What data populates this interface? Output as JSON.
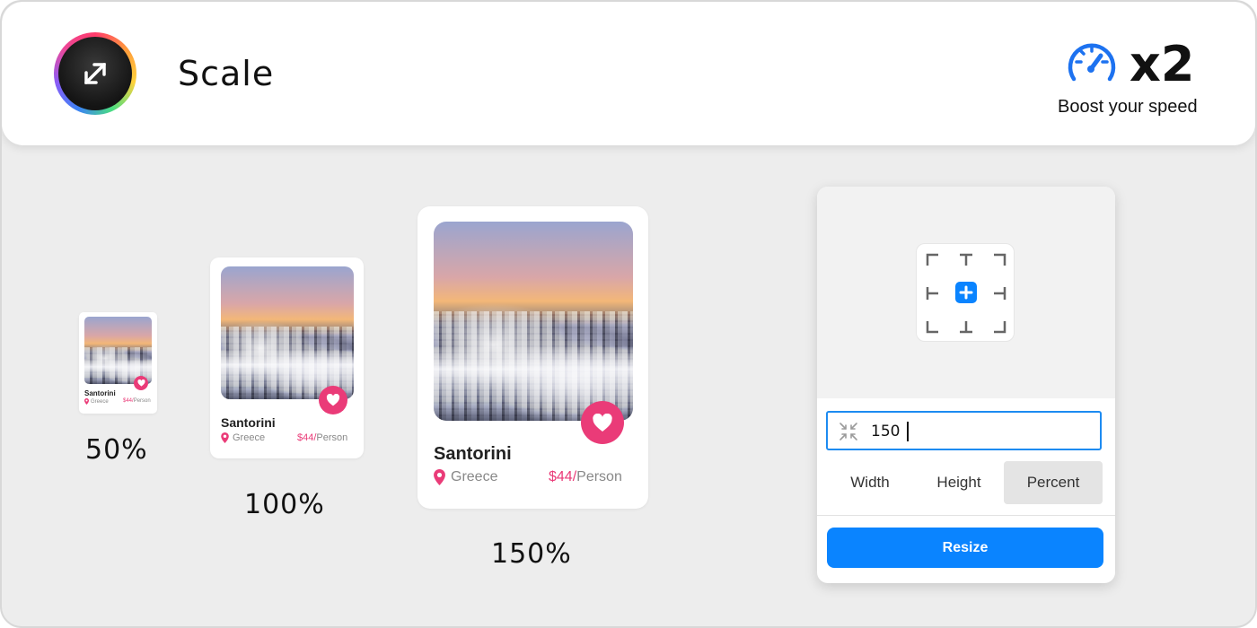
{
  "header": {
    "title": "Scale",
    "speed_value": "x2",
    "speed_caption": "Boost your speed"
  },
  "cards": [
    {
      "scale": "50%",
      "title": "Santorini",
      "location": "Greece",
      "price": "$44/",
      "unit": "Person"
    },
    {
      "scale": "100%",
      "title": "Santorini",
      "location": "Greece",
      "price": "$44/",
      "unit": "Person"
    },
    {
      "scale": "150%",
      "title": "Santorini",
      "location": "Greece",
      "price": "$44/",
      "unit": "Person"
    }
  ],
  "panel": {
    "input_value": "150",
    "modes": [
      "Width",
      "Height",
      "Percent"
    ],
    "selected_mode": "Percent",
    "resize_label": "Resize"
  },
  "colors": {
    "accent_pink": "#ea3b78",
    "accent_blue": "#0a84ff",
    "speed_blue": "#1d72f0"
  }
}
